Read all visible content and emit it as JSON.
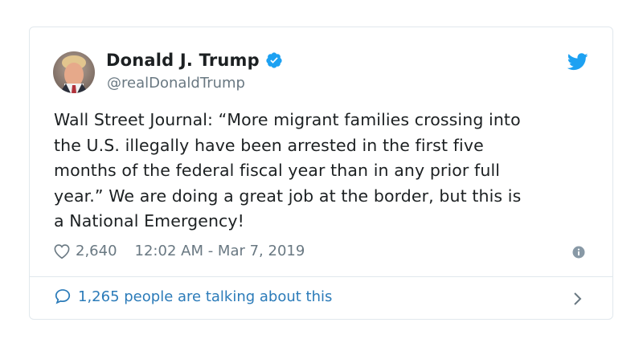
{
  "tweet": {
    "author_name": "Donald J. Trump",
    "handle": "@realDonaldTrump",
    "text": "Wall Street Journal: “More migrant families crossing into\nthe U.S. illegally have been arrested in the first five\nmonths of the federal fiscal year than in any prior full\nyear.” We are doing a great job at the border, but this is\na National Emergency!",
    "likes": "2,640",
    "timestamp": "12:02 AM - Mar 7, 2019",
    "talking": "1,265 people are talking about this"
  },
  "icons": {
    "avatar": "avatar",
    "verified": "verified-badge-icon",
    "brand": "twitter-bird-icon",
    "like": "heart-icon",
    "info": "info-icon",
    "reply": "speech-bubble-icon",
    "more": "chevron-right-icon"
  },
  "colors": {
    "link": "#2b7bb9",
    "brand": "#1da1f2",
    "muted": "#697882",
    "text": "#1c2022",
    "border": "#e1e8ed"
  }
}
